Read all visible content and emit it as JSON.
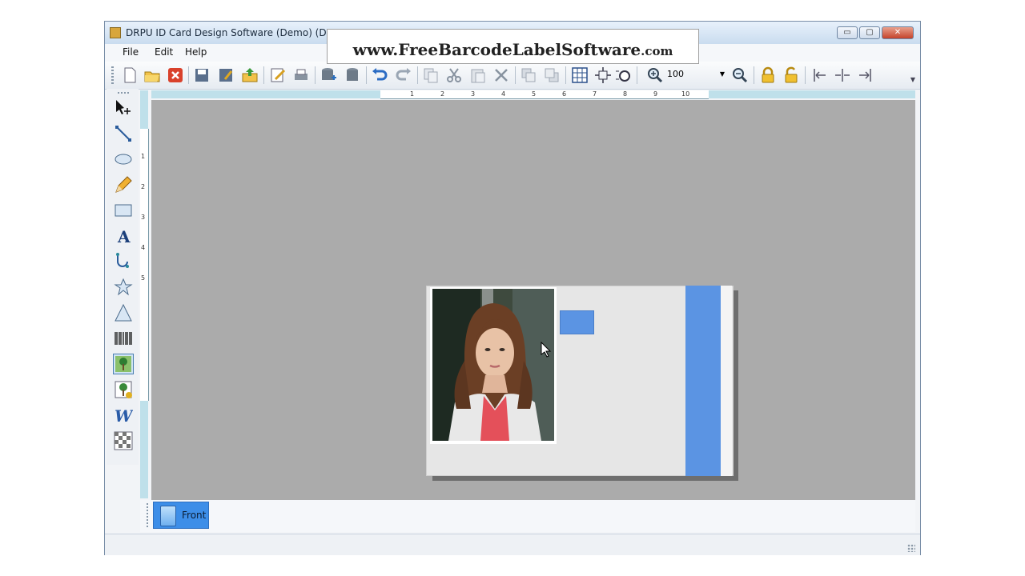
{
  "window": {
    "title": "DRPU ID Card Design Software (Demo) (Docum",
    "buttons": {
      "minimize": "▭",
      "maximize": "▢",
      "close": "✕"
    }
  },
  "banner": {
    "main": "www.FreeBarcodeLabelSoftware",
    "suffix": ".com"
  },
  "menu": {
    "items": [
      "File",
      "Edit",
      "Help"
    ]
  },
  "toolbar": {
    "zoom_value": "100",
    "icons": [
      "new-icon",
      "open-icon",
      "close-doc-icon",
      "save-icon",
      "save-as-icon",
      "export-icon",
      "edit-icon",
      "print-icon",
      "database-add-icon",
      "database-icon",
      "undo-icon",
      "redo-icon",
      "copy-icon",
      "cut-icon",
      "paste-icon",
      "delete-icon",
      "bring-front-icon",
      "send-back-icon",
      "grid-icon",
      "fit-icon",
      "zoom-fit-icon",
      "zoom-in-icon",
      "zoom-out-icon",
      "lock-icon",
      "unlock-icon",
      "align-left-icon",
      "align-center-icon",
      "align-right-icon"
    ]
  },
  "tools": [
    "pointer-tool-icon",
    "line-tool-icon",
    "ellipse-tool-icon",
    "pencil-tool-icon",
    "rectangle-tool-icon",
    "text-tool-icon",
    "arc-tool-icon",
    "star-tool-icon",
    "triangle-tool-icon",
    "barcode-tool-icon",
    "picture-tool-icon",
    "image-library-tool-icon",
    "word-art-tool-icon",
    "watermark-tool-icon"
  ],
  "ruler": {
    "h_ticks": [
      "1",
      "2",
      "3",
      "4",
      "5",
      "6",
      "7",
      "8",
      "9",
      "10"
    ],
    "v_ticks": [
      "1",
      "2",
      "3",
      "4",
      "5"
    ]
  },
  "tabs": {
    "front": "Front"
  },
  "colors": {
    "accent_blue": "#5b94e3",
    "canvas_gray": "#ababab",
    "tab_blue": "#3d8ee8"
  }
}
